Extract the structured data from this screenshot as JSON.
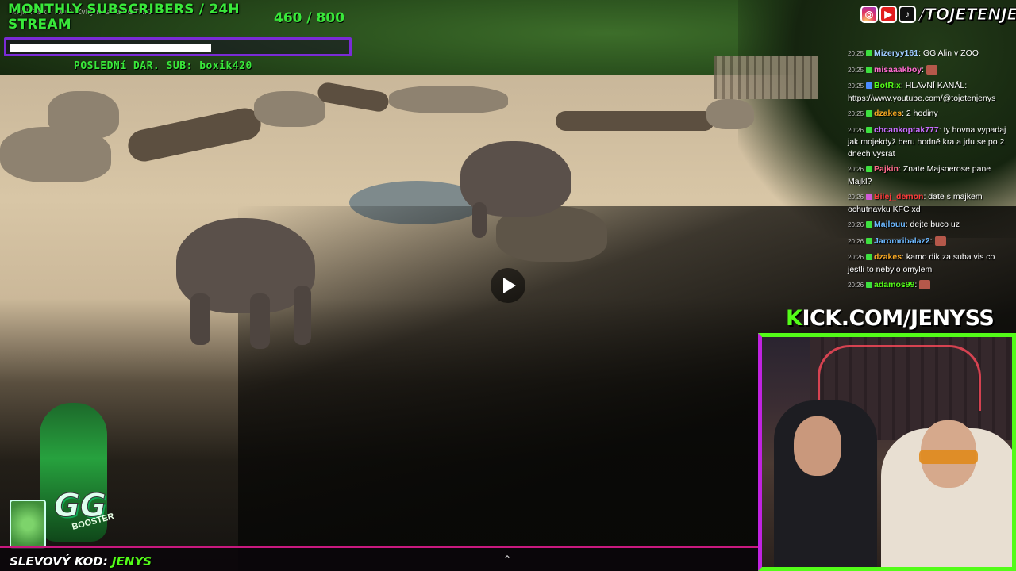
{
  "stream": {
    "subs_title_line1": "MONTHLY SUBSCRIBERS / 24H",
    "subs_title_line2": "STREAM",
    "subs_count": "460  / 800",
    "subs_progress": 0.575,
    "video_title": "Majkl Park v ZOO. Zvíry naso a POTRIO",
    "last_sub": "POSLEDNí DAR. SUB: boxik420"
  },
  "social": {
    "icons": [
      "instagram-icon",
      "youtube-icon",
      "tiktok-icon"
    ],
    "handle": "/TOJETENJENYS"
  },
  "chat": {
    "messages": [
      {
        "time": "20:25",
        "user": "Mizeryy161",
        "text": ": GG Alin v ZOO",
        "color": "#9ecbff",
        "badge": "green"
      },
      {
        "time": "20:25",
        "user": "misaaakboy",
        "text": ":",
        "color": "#ff6bd1",
        "badge": "green",
        "emote": true
      },
      {
        "time": "20:25",
        "user": "BotRix",
        "text": ": HLAVNÍ KANÁL: https://www.youtube.com/@tojetenjenys",
        "color": "#53fc18",
        "badge": "blue"
      },
      {
        "time": "20:25",
        "user": "dzakes",
        "text": ": 2 hodiny",
        "color": "#f5a623",
        "badge": "green"
      },
      {
        "time": "20:26",
        "user": "chcankoptak777",
        "text": ": ty hovna vypadaj jak mojekdyž beru hodně kra a jdu se po 2 dnech vysrat",
        "color": "#c86dff",
        "badge": "green"
      },
      {
        "time": "20:26",
        "user": "Pajkin",
        "text": ": Znate Majsnerose pane Majkl?",
        "color": "#ff6b8b",
        "badge": "green"
      },
      {
        "time": "20:26",
        "user": "Bilej_demon",
        "text": ": date s majkem ochutnavku KFC xd",
        "color": "#ff3b3b",
        "badge": "pink"
      },
      {
        "time": "20:26",
        "user": "Majlouu",
        "text": ": dejte buco uz",
        "color": "#6ab7ff",
        "badge": "green"
      },
      {
        "time": "20:26",
        "user": "Jaromribalaz2",
        "text": ":",
        "color": "#6ab7ff",
        "badge": "green",
        "emote": true
      },
      {
        "time": "20:26",
        "user": "dzakes",
        "text": ": kamo dik za suba vis co jestli to nebylo omylem",
        "color": "#f5a623",
        "badge": "green"
      },
      {
        "time": "20:26",
        "user": "adamos99",
        "text": ":",
        "color": "#53fc18",
        "badge": "green",
        "emote": true
      }
    ]
  },
  "kick": {
    "k": "K",
    "rest": "ICK.COM/JENYSS"
  },
  "sponsor": {
    "logo": "GG",
    "logo_sub": "BOOSTER",
    "discount_label": "SLEVOVÝ KOD: ",
    "discount_code": "JENYS"
  },
  "colors": {
    "accent_green": "#53fc18",
    "accent_purple": "#7a2bd6",
    "accent_pink": "#c8197f"
  }
}
